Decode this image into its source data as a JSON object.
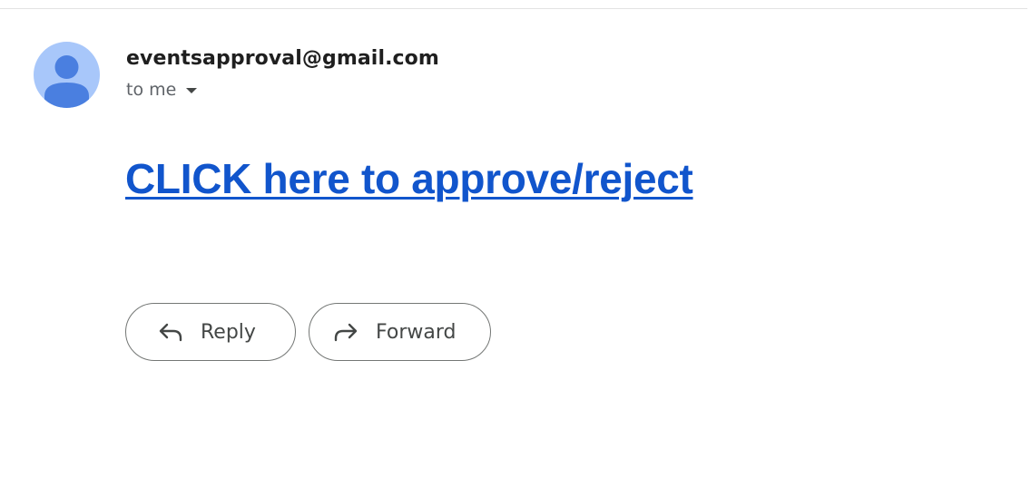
{
  "email": {
    "sender": "eventsapproval@gmail.com",
    "recipient": "to me",
    "body_link_text": "CLICK here to approve/reject"
  },
  "actions": {
    "reply_label": "Reply",
    "forward_label": "Forward"
  },
  "colors": {
    "link": "#1155cc",
    "avatar_background": "#a8c7fa",
    "avatar_figure": "#4a7fe0",
    "button_border": "#747775"
  },
  "icons": {
    "avatar": "person-avatar-icon",
    "recipient_details": "caret-down-icon",
    "reply": "reply-arrow-icon",
    "forward": "forward-arrow-icon"
  }
}
